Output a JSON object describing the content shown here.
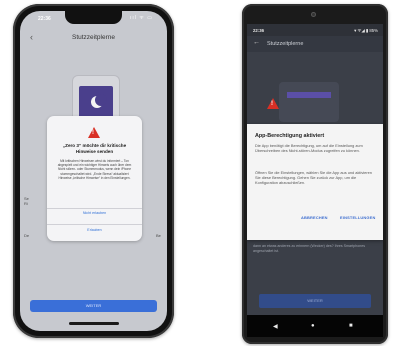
{
  "ios": {
    "status_time": "22:36",
    "status_icons": "ııl ᯤ ▭",
    "nav_back": "‹",
    "title": "Stutzzeitplerne",
    "dialog": {
      "heading": "„Zero 3“ möchte dir kritische Hinweise senden",
      "body": "Mit kritischen Hinweisen wirst du informiert – Ton abgespielt und ein wichtiger Hinweis auch über dem Nicht stören- oder Stummmodus, wenn dein iPhone stummgeschaltet wird. „Ende Stress“ aktualisiert Hinweise „kritische Hinweise“ in den Einstellungen.",
      "action_allow": "Nicht erlauben",
      "action_deny": "Erlauben"
    },
    "bg_text_1": "Se\nRi",
    "bg_text_2": "De",
    "bg_text_3": "Be",
    "bottom_button": "WEITER"
  },
  "android": {
    "status_time": "22:36",
    "status_icons": "▾ ᯤ◢ ▮ 85%",
    "nav_back": "←",
    "title": "Stutzzeitplerne",
    "dialog": {
      "heading": "App-Berechtigung aktiviert",
      "p1": "Die App benötigt die Berechtigung, um auf die Einstellung zum Überschreiben des Nicht-stören-Modus zugreifen zu können.",
      "p2": "Öffnen Sie die Einstellungen, wählen Sie die App aus und aktivieren Sie diese Berechtigung. Gehen Sie zurück zur App, um die Konfiguration abzuschließen.",
      "btn_cancel": "ABBRECHEN",
      "btn_settings": "EINSTELLUNGEN"
    },
    "bg_text": "dann an etwas anderes zu erinnern (Wecker) des? Ihres Smartphones angeschaltet ist.",
    "bottom_button": "WEITER",
    "nav_back_btn": "◀",
    "nav_home_btn": "●",
    "nav_recent_btn": "■"
  }
}
